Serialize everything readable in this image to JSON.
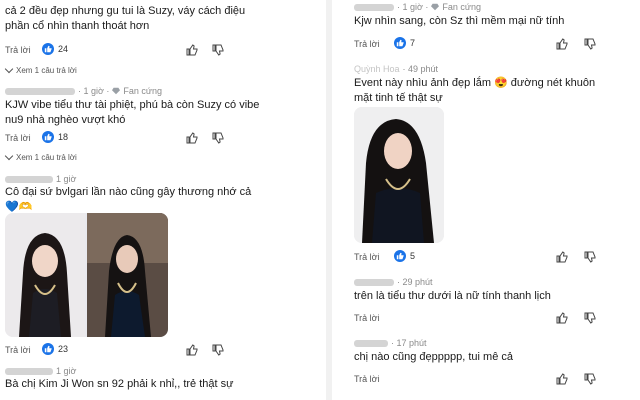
{
  "left": {
    "c1": {
      "text_line1": "cả 2 đều đẹp nhưng gu tui là Suzy, váy cách điệu",
      "text_line2": "phần cổ nhìn thanh thoát hơn",
      "reply_label": "Trả lời",
      "likes": "24",
      "view_replies": "Xem 1 câu trả lời"
    },
    "c2": {
      "time": "· 1 giờ ·",
      "badge": "Fan cứng",
      "text_line1": "KJW vibe tiểu thư tài phiệt, phú bà còn Suzy có vibe",
      "text_line2": "nu9 nhà nghèo vượt khó",
      "reply_label": "Trả lời",
      "likes": "18",
      "view_replies": "Xem 1 câu trả lời"
    },
    "c3": {
      "time": "1 giờ",
      "text_line1": "Cô đại sứ bvlgari lần nào cũng gây thương nhớ cả",
      "emoji_line": "💙🫶",
      "reply_label": "Trả lời",
      "likes": "23"
    },
    "c4": {
      "time": "1 giờ",
      "text_line1": "Bà chị Kim Ji Won sn 92 phải k nhỉ,, trẻ thật sự"
    }
  },
  "right": {
    "r1": {
      "time": "· 1 giờ ·",
      "badge": "Fan cứng",
      "text_line1": "Kjw nhìn sang, còn Sz thì mềm mại nữ tính",
      "reply_label": "Trả lời",
      "likes": "7"
    },
    "r2": {
      "name_partial": "Quỳnh Hoa",
      "time": "· 49 phút",
      "text_line1": "Event này nhìu ảnh đẹp lắm 😍 đường nét khuôn",
      "text_line2": "mặt tinh tế thật sự",
      "reply_label": "Trả lời",
      "likes": "5"
    },
    "r3": {
      "time": "· 29 phút",
      "text_line1": "trên là tiểu thư dưới là nữ tính thanh lịch",
      "reply_label": "Trả lời"
    },
    "r4": {
      "time": "· 17 phút",
      "text_line1": "chị nào cũng đẹppppp, tui mê cả",
      "reply_label": "Trả lời"
    }
  },
  "colors": {
    "like_blue": "#1a73e8",
    "text": "#1a1a1a",
    "meta": "#8a8a8a"
  },
  "icons": [
    "like-icon",
    "thumbs-up-icon",
    "thumbs-down-icon",
    "diamond-icon",
    "chevron-down-icon"
  ]
}
